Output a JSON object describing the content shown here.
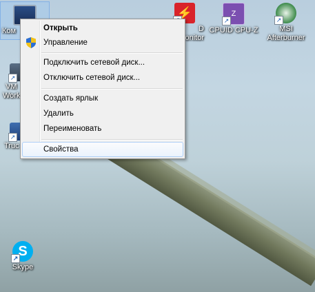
{
  "desktop": {
    "icons": [
      {
        "label": "Компьютер",
        "shown": "Ком"
      },
      {
        "label": "VM Workstation",
        "shown1": "VM",
        "shown2": "Work"
      },
      {
        "label": "Truc",
        "shown": "Truc"
      },
      {
        "label": "Skype",
        "shown": "Skype"
      },
      {
        "label": "HWMonitor",
        "shown1": "D",
        "shown2": "onitor"
      },
      {
        "label": "CPUID CPU-Z",
        "shown": "CPUID CPU-Z"
      },
      {
        "label": "MSI Afterburner",
        "shown1": "MSI",
        "shown2": "Afterburner"
      }
    ]
  },
  "context_menu": {
    "items": {
      "open": "Открыть",
      "manage": "Управление",
      "map_drive": "Подключить сетевой диск...",
      "disconnect_drive": "Отключить сетевой диск...",
      "create_shortcut": "Создать ярлык",
      "delete": "Удалить",
      "rename": "Переименовать",
      "properties": "Свойства"
    }
  },
  "colors": {
    "hover_border": "#aecff7",
    "menu_bg": "#f0f0f0",
    "skype_blue": "#00aff0",
    "cpuz_purple": "#7b4fb0",
    "hwmonitor_red": "#d9232a"
  }
}
